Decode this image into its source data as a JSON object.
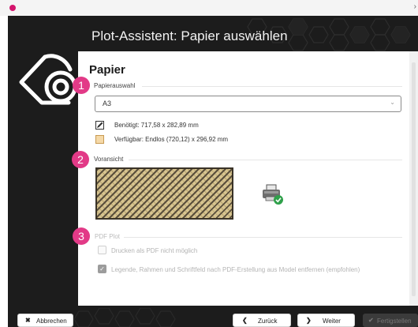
{
  "window": {
    "close_glyph": "›"
  },
  "wizard": {
    "title": "Plot-Assistent: Papier auswählen"
  },
  "page": {
    "heading": "Papier"
  },
  "badges": [
    "1",
    "2",
    "3"
  ],
  "paper": {
    "section_label": "Papierauswahl",
    "selected": "A3",
    "required_icon": "pencil-icon",
    "required": "Benötigt: 717,58 x 282,89 mm",
    "available_icon": "paper-swatch-icon",
    "available": "Verfügbar: Endlos (720,12) x 296,92 mm"
  },
  "preview": {
    "section_label": "Voransicht",
    "printer_icon": "printer-ready-icon"
  },
  "pdf": {
    "section_label": "PDF Plot",
    "option1": "Drucken als PDF nicht möglich",
    "option1_checked": false,
    "option2": "Legende, Rahmen und Schriftfeld nach PDF-Erstellung aus Model entfernen (empfohlen)",
    "option2_checked": true
  },
  "footer": {
    "cancel_glyph": "✖",
    "cancel": "Abbrechen",
    "back_glyph": "❮",
    "back": "Zurück",
    "next_glyph": "❯",
    "next": "Weiter",
    "finish_glyph": "✔",
    "finish": "Fertigstellen"
  }
}
